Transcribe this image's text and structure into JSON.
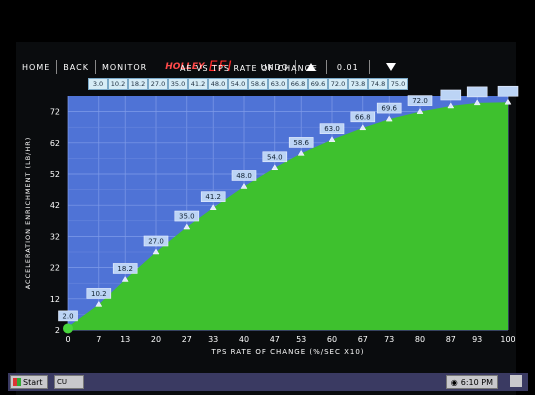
{
  "nav": {
    "home": "HOME",
    "back": "BACK",
    "monitor": "MONITOR",
    "brand": "HOLLEY",
    "efi": "EFI",
    "undo": "UNDO",
    "value": "0.01"
  },
  "chart_title": "AE VS TPS RATE OF CHANGE",
  "table_values": [
    "3.0",
    "10.2",
    "18.2",
    "27.0",
    "35.0",
    "41.2",
    "48.0",
    "54.0",
    "58.6",
    "63.0",
    "66.8",
    "69.6",
    "72.0",
    "73.8",
    "74.8",
    "75.0"
  ],
  "chart_data": {
    "type": "area",
    "ylabel": "ACCELERATION ENRICHMENT (LB/HR)",
    "xlabel": "TPS RATE OF CHANGE (%/SEC X10)",
    "xticks": [
      "0",
      "7",
      "13",
      "20",
      "27",
      "33",
      "40",
      "47",
      "53",
      "60",
      "67",
      "73",
      "80",
      "87",
      "93",
      "100"
    ],
    "yticks": [
      "2",
      "12",
      "22",
      "32",
      "42",
      "52",
      "62",
      "72"
    ],
    "ylim": [
      2,
      77
    ],
    "x": [
      0,
      7,
      13,
      20,
      27,
      33,
      40,
      47,
      53,
      60,
      67,
      73,
      80,
      87,
      93,
      100
    ],
    "values": [
      3.0,
      10.2,
      18.2,
      27.0,
      35.0,
      41.2,
      48.0,
      54.0,
      58.6,
      63.0,
      66.8,
      69.6,
      72.0,
      73.8,
      74.8,
      75.0
    ],
    "labels": [
      "2.0",
      "10.2",
      "18.2",
      "27.0",
      "35.0",
      "41.2",
      "48.0",
      "54.0",
      "58.6",
      "63.0",
      "66.8",
      "69.6",
      "72.0",
      "",
      "",
      ""
    ],
    "fill_color": "#3ec12e",
    "bg_color": "#4f73d6",
    "grid": true
  },
  "taskbar": {
    "start": "Start",
    "task": "CU",
    "time": "6:10 PM"
  }
}
